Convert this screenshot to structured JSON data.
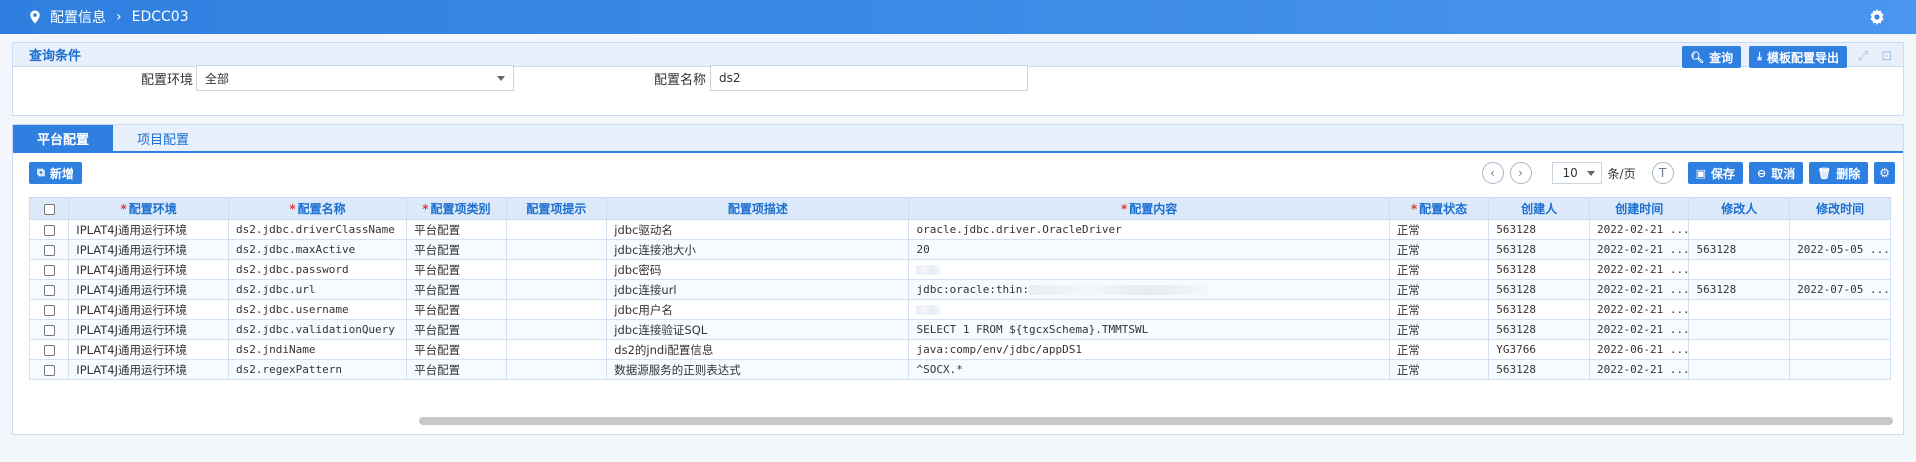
{
  "breadcrumb": {
    "root": "配置信息",
    "current": "EDCC03"
  },
  "query": {
    "title": "查询条件",
    "search_btn": "查询",
    "export_btn": "模板配置导出",
    "env_label": "配置环境",
    "env_value": "全部",
    "name_label": "配置名称",
    "name_value": "ds2"
  },
  "tabs": [
    "平台配置",
    "项目配置"
  ],
  "toolbar": {
    "add_btn": "新增",
    "page_size": "10",
    "per_page": "条/页",
    "save_btn": "保存",
    "cancel_btn": "取消",
    "delete_btn": "删除"
  },
  "columns": [
    {
      "label": "配置环境",
      "required": true
    },
    {
      "label": "配置名称",
      "required": true
    },
    {
      "label": "配置项类别",
      "required": true
    },
    {
      "label": "配置项提示",
      "required": false
    },
    {
      "label": "配置项描述",
      "required": false
    },
    {
      "label": "配置内容",
      "required": true
    },
    {
      "label": "配置状态",
      "required": true
    },
    {
      "label": "创建人",
      "required": false
    },
    {
      "label": "创建时间",
      "required": false
    },
    {
      "label": "修改人",
      "required": false
    },
    {
      "label": "修改时间",
      "required": false
    }
  ],
  "rows": [
    [
      "IPLAT4J通用运行环境",
      "ds2.jdbc.driverClassName",
      "平台配置",
      "",
      "jdbc驱动名",
      "oracle.jdbc.driver.OracleDriver",
      "正常",
      "563128",
      "2022-02-21 ...",
      "",
      ""
    ],
    [
      "IPLAT4J通用运行环境",
      "ds2.jdbc.maxActive",
      "平台配置",
      "",
      "jdbc连接池大小",
      "20",
      "正常",
      "563128",
      "2022-02-21 ...",
      "563128",
      "2022-05-05 ..."
    ],
    [
      "IPLAT4J通用运行环境",
      "ds2.jdbc.password",
      "平台配置",
      "",
      "jdbc密码",
      "",
      "正常",
      "563128",
      "2022-02-21 ...",
      "",
      ""
    ],
    [
      "IPLAT4J通用运行环境",
      "ds2.jdbc.url",
      "平台配置",
      "",
      "jdbc连接url",
      "jdbc:oracle:thin:",
      "正常",
      "563128",
      "2022-02-21 ...",
      "563128",
      "2022-07-05 ..."
    ],
    [
      "IPLAT4J通用运行环境",
      "ds2.jdbc.username",
      "平台配置",
      "",
      "jdbc用户名",
      "",
      "正常",
      "563128",
      "2022-02-21 ...",
      "",
      ""
    ],
    [
      "IPLAT4J通用运行环境",
      "ds2.jdbc.validationQuery",
      "平台配置",
      "",
      "jdbc连接验证SQL",
      "SELECT 1 FROM ${tgcxSchema}.TMMTSWL",
      "正常",
      "563128",
      "2022-02-21 ...",
      "",
      ""
    ],
    [
      "IPLAT4J通用运行环境",
      "ds2.jndiName",
      "平台配置",
      "",
      "ds2的jndi配置信息",
      "java:comp/env/jdbc/appDS1",
      "正常",
      "YG3766",
      "2022-06-21 ...",
      "",
      ""
    ],
    [
      "IPLAT4J通用运行环境",
      "ds2.regexPattern",
      "平台配置",
      "",
      "数据源服务的正则表达式",
      "^SOCX.*",
      "正常",
      "563128",
      "2022-02-21 ...",
      "",
      ""
    ]
  ]
}
